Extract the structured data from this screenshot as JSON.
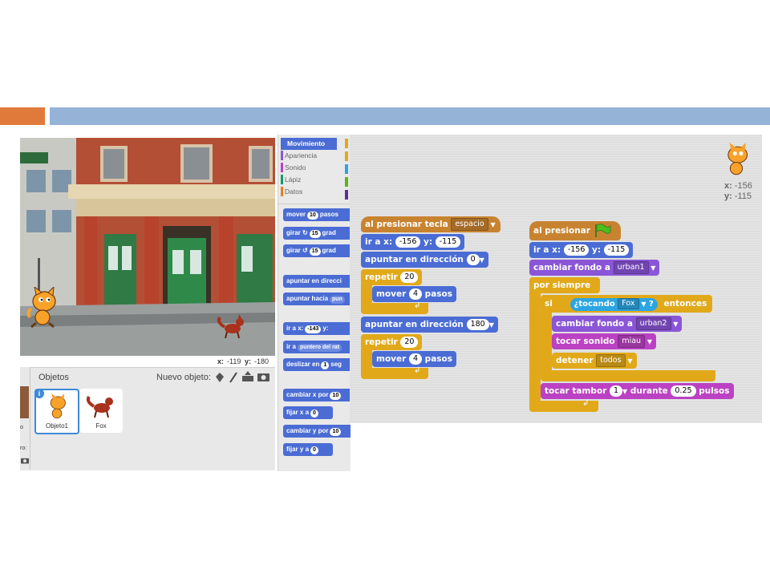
{
  "stage": {
    "x_label": "x:",
    "x_value": "-119",
    "y_label": "y:",
    "y_value": "-180"
  },
  "sprites_pane": {
    "title": "Objetos",
    "new_object_label": "Nuevo objeto:",
    "sprites": [
      {
        "name": "Objeto1"
      },
      {
        "name": "Fox"
      }
    ],
    "left_strip_text_1": "o",
    "left_strip_text_2": "ro:"
  },
  "palette": {
    "categories": [
      {
        "label": "Movimiento",
        "color": "#4a6cd4"
      },
      {
        "label": "Apariencia",
        "color": "#8a55d7"
      },
      {
        "label": "Sonido",
        "color": "#bb42c3"
      },
      {
        "label": "Lápiz",
        "color": "#0e9a6c"
      },
      {
        "label": "Datos",
        "color": "#ee7d16"
      }
    ],
    "blocks": {
      "mover_pre": "mover",
      "mover_n": "10",
      "mover_post": "pasos",
      "girar_r_pre": "girar",
      "girar_r_n": "15",
      "girar_r_post": "grad",
      "girar_l_pre": "girar",
      "girar_l_n": "15",
      "girar_l_post": "grad",
      "apuntar_dir": "apuntar en direcci",
      "apuntar_hacia_pre": "apuntar hacia",
      "apuntar_hacia_dd": "pun",
      "ir_a_x_pre": "ir a x:",
      "ir_a_x_n": "-143",
      "ir_a_x_post": "y:",
      "ir_a_pre": "ir a",
      "ir_a_dd": "puntero del rat",
      "deslizar_pre": "deslizar en",
      "deslizar_n": "1",
      "deslizar_post": "seg",
      "cambiar_x_pre": "cambiar x por",
      "cambiar_x_n": "10",
      "fijar_x_pre": "fijar x a",
      "fijar_x_n": "0",
      "cambiar_y_pre": "cambiar y por",
      "cambiar_y_n": "10",
      "fijar_y_pre": "fijar y a",
      "fijar_y_n": "0"
    }
  },
  "script_area": {
    "sprite_x_label": "x:",
    "sprite_x": "-156",
    "sprite_y_label": "y:",
    "sprite_y": "-115",
    "script1": {
      "hat_pre": "al presionar tecla",
      "hat_key": "espacio",
      "goto_pre": "ir a x:",
      "goto_x": "-156",
      "goto_mid": "y:",
      "goto_y": "-115",
      "point1_pre": "apuntar en dirección",
      "point1_val": "0",
      "repeat1_pre": "repetir",
      "repeat1_val": "20",
      "move1_pre": "mover",
      "move1_val": "4",
      "move1_post": "pasos",
      "point2_pre": "apuntar en dirección",
      "point2_val": "180",
      "repeat2_pre": "repetir",
      "repeat2_val": "20",
      "move2_pre": "mover",
      "move2_val": "4",
      "move2_post": "pasos"
    },
    "script2": {
      "hat_pre": "al presionar",
      "goto_pre": "ir a x:",
      "goto_x": "-156",
      "goto_mid": "y:",
      "goto_y": "-115",
      "backdrop1_pre": "cambiar fondo a",
      "backdrop1_val": "urban1",
      "forever": "por siempre",
      "if_pre": "si",
      "touching_pre": "¿tocando",
      "touching_val": "Fox",
      "touching_q": "?",
      "if_post": "entonces",
      "backdrop2_pre": "cambiar fondo a",
      "backdrop2_val": "urban2",
      "sound_pre": "tocar sonido",
      "sound_val": "miau",
      "stop_pre": "detener",
      "stop_val": "todos",
      "drum_pre": "tocar tambor",
      "drum_val": "1",
      "drum_mid": "durante",
      "drum_beats": "0.25",
      "drum_post": "pulsos"
    }
  },
  "colors": {
    "accent_orange": "#e07a3b",
    "accent_blue": "#95b3d7"
  }
}
